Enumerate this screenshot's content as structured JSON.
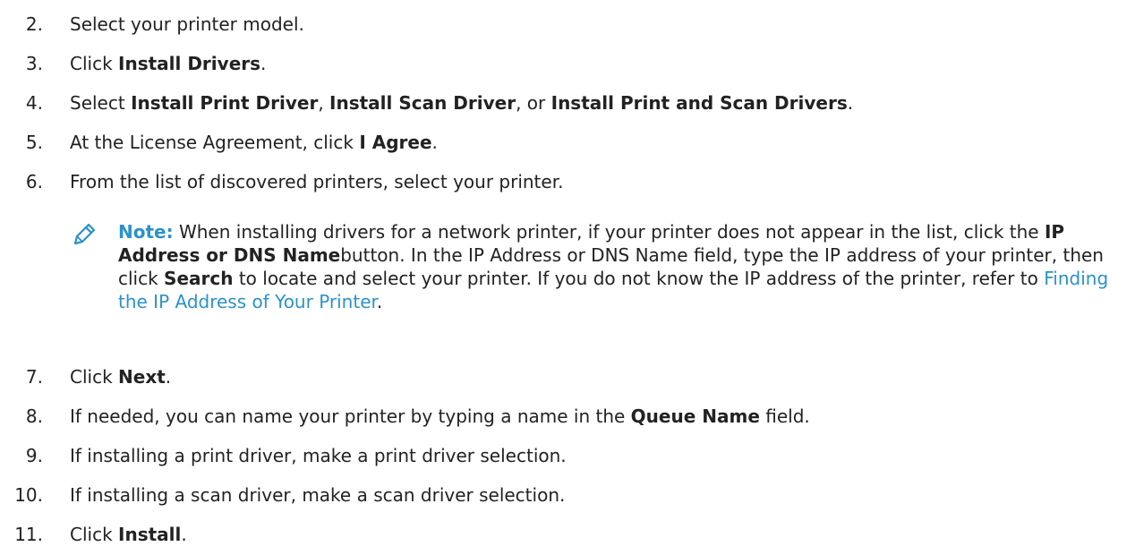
{
  "steps": [
    {
      "num": "2.",
      "parts": [
        {
          "t": "Select your printer model."
        }
      ]
    },
    {
      "num": "3.",
      "parts": [
        {
          "t": "Click "
        },
        {
          "t": "Install Drivers",
          "b": true
        },
        {
          "t": "."
        }
      ]
    },
    {
      "num": "4.",
      "parts": [
        {
          "t": "Select "
        },
        {
          "t": "Install Print Driver",
          "b": true
        },
        {
          "t": ", "
        },
        {
          "t": "Install Scan Driver",
          "b": true
        },
        {
          "t": ", or "
        },
        {
          "t": "Install Print and Scan Drivers",
          "b": true
        },
        {
          "t": "."
        }
      ]
    },
    {
      "num": "5.",
      "parts": [
        {
          "t": "At the License Agreement, click "
        },
        {
          "t": "I Agree",
          "b": true
        },
        {
          "t": "."
        }
      ]
    },
    {
      "num": "6.",
      "parts": [
        {
          "t": "From the list of discovered printers, select your printer."
        }
      ]
    },
    {
      "num": "7.",
      "parts": [
        {
          "t": "Click "
        },
        {
          "t": "Next",
          "b": true
        },
        {
          "t": "."
        }
      ]
    },
    {
      "num": "8.",
      "parts": [
        {
          "t": "If needed, you can name your printer by typing a name in the "
        },
        {
          "t": "Queue Name",
          "b": true
        },
        {
          "t": " field."
        }
      ]
    },
    {
      "num": "9.",
      "parts": [
        {
          "t": "If installing a print driver, make a print driver selection."
        }
      ]
    },
    {
      "num": "10.",
      "parts": [
        {
          "t": "If installing a scan driver, make a scan driver selection."
        }
      ]
    },
    {
      "num": "11.",
      "parts": [
        {
          "t": "Click "
        },
        {
          "t": "Install",
          "b": true
        },
        {
          "t": "."
        }
      ]
    }
  ],
  "note": {
    "icon": "pencil-icon",
    "label": "Note:",
    "text_1": " When installing drivers for a network printer, if your printer does not appear in the list, click the ",
    "bold_1": "IP Address or DNS Name",
    "text_2": "button. In the IP Address or DNS Name field, type the IP address of your printer, then click ",
    "bold_2": "Search",
    "text_3": " to locate and select your printer. If you do not know the IP address of the printer, refer to ",
    "link": "Finding the IP Address of Your Printer",
    "text_4": "."
  },
  "colors": {
    "accent": "#2a92c9",
    "text": "#222222"
  }
}
